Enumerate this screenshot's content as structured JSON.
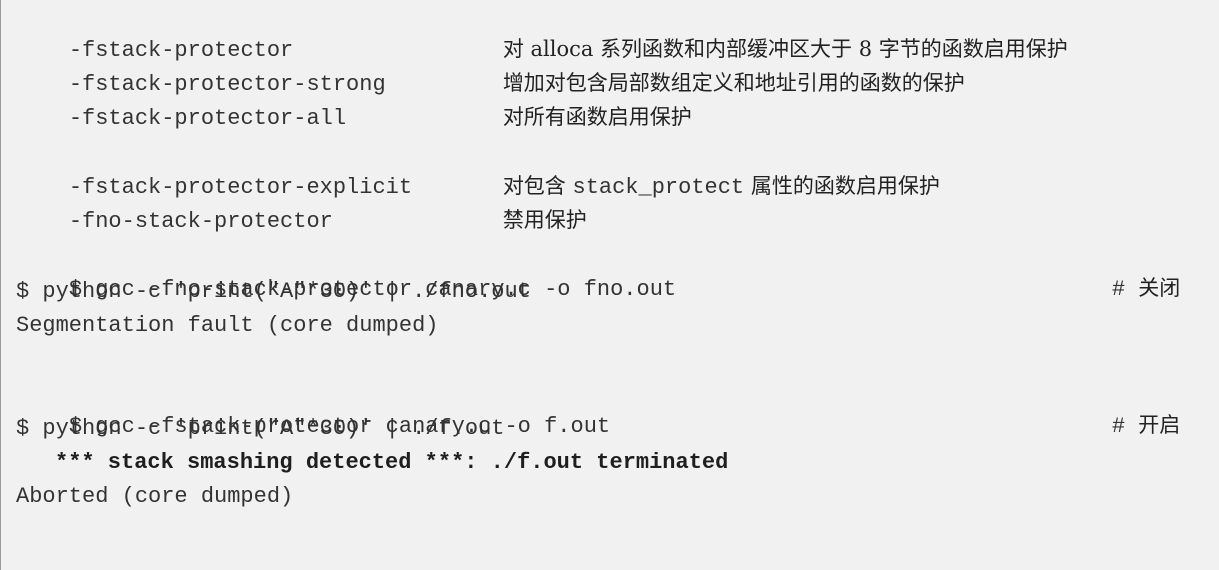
{
  "options": [
    {
      "flag": "-fstack-protector",
      "desc": "对 alloca 系列函数和内部缓冲区大于 8 字节的函数启用保护"
    },
    {
      "flag": "-fstack-protector-strong",
      "desc": "增加对包含局部数组定义和地址引用的函数的保护"
    },
    {
      "flag": "-fstack-protector-all",
      "desc": "对所有函数启用保护"
    },
    {
      "flag": "-fstack-protector-explicit",
      "desc_before": "对包含",
      "desc_mono": "stack_protect",
      "desc_after": "属性的函数启用保护"
    },
    {
      "flag": "-fno-stack-protector",
      "desc": "禁用保护"
    }
  ],
  "session1": {
    "cmd1": "$ gcc -fno-stack-protector canary.c -o fno.out",
    "comment1_hash": "#",
    "comment1_text": "关闭",
    "cmd2": "$ python -c 'print(\"A\"*30)' | ./fno.out",
    "output": "Segmentation fault (core dumped)"
  },
  "session2": {
    "cmd1": "$ gcc -fstack-protector canary.c -o f.out",
    "comment1_hash": "#",
    "comment1_text": "开启",
    "cmd2": "$ python -c 'print(\"A\"*30)' | ./f.out",
    "smash": "*** stack smashing detected ***: ./f.out terminated",
    "output": "Aborted (core dumped)"
  }
}
